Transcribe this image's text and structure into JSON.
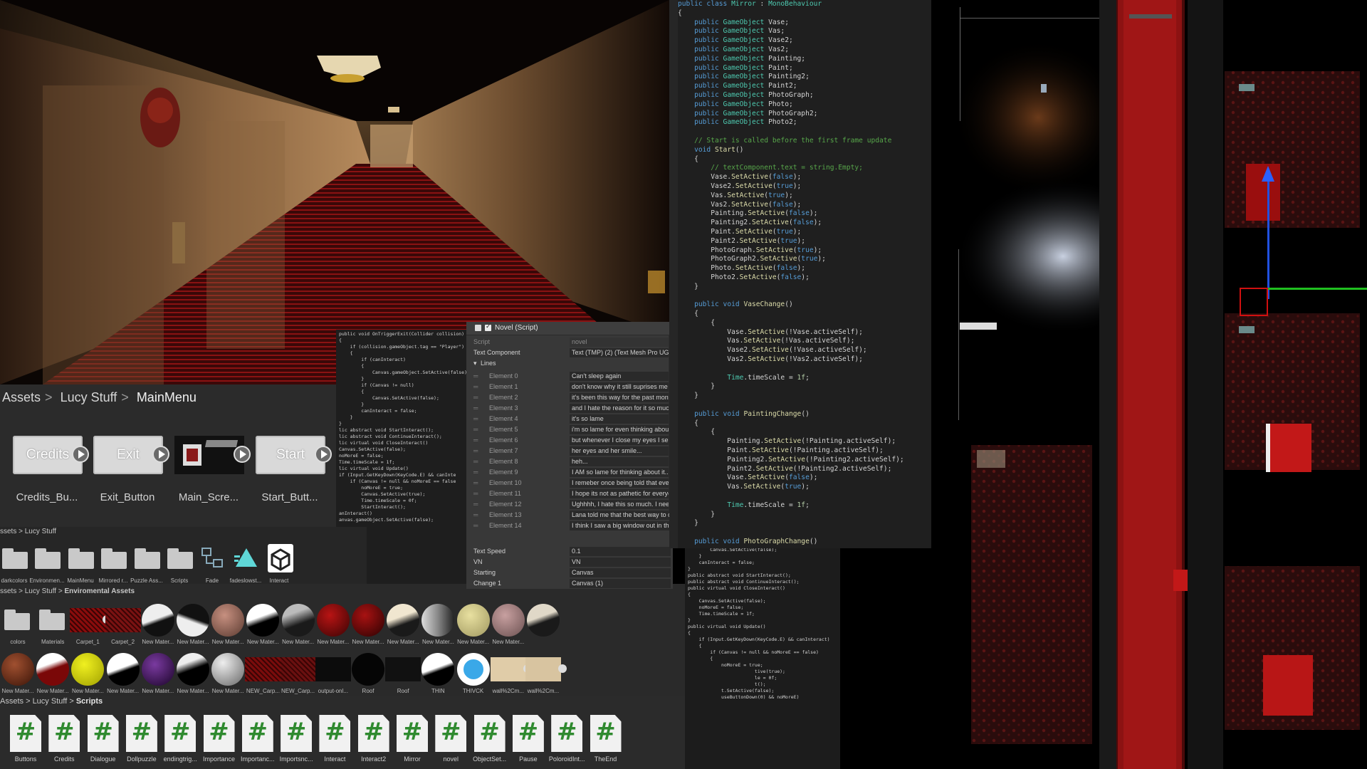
{
  "colors": {
    "accent_red": "#b11515",
    "editor_bg": "#1f1f1f",
    "panel_bg": "#2b2b2b"
  },
  "project": {
    "breadcrumb": [
      "Assets",
      "Lucy Stuff",
      "MainMenu"
    ],
    "prefabs": [
      {
        "card": "Credits",
        "label": "Credits_Bu..."
      },
      {
        "card": "Exit",
        "label": "Exit_Button"
      },
      {
        "card": "",
        "label": "Main_Scre..."
      },
      {
        "card": "Start",
        "label": "Start_Butt..."
      }
    ]
  },
  "folders_panel": {
    "breadcrumb": [
      "ssets",
      "Lucy Stuff"
    ],
    "items": [
      "darkcolors",
      "Environmen...",
      "MainMenu",
      "Mirrored r...",
      "Puzzle Ass...",
      "Scripts",
      "Fade",
      "fadeslowst...",
      "Interact"
    ]
  },
  "materials_panel": {
    "breadcrumb": [
      "ssets",
      "Lucy Stuff",
      "Enviromental Assets"
    ],
    "row1": [
      "colors",
      "Materials",
      "Carpet_1",
      "Carpet_2",
      "New Mater...",
      "New Mater...",
      "New Mater...",
      "New Mater...",
      "New Mater...",
      "New Mater...",
      "New Mater...",
      "New Mater...",
      "New Mater...",
      "New Mater...",
      "New Mater..."
    ],
    "row2": [
      "New Mater...",
      "New Mater...",
      "New Mater...",
      "New Mater...",
      "New Mater...",
      "New Mater...",
      "New Mater...",
      "NEW_Carp...",
      "NEW_Carp...",
      "output-onl...",
      "Roof",
      "Roof",
      "THIN",
      "THIVCK",
      "wall%2Cm...",
      "wall%2Cm..."
    ]
  },
  "scripts_panel": {
    "breadcrumb": [
      "Assets",
      "Lucy Stuff",
      "Scripts"
    ],
    "items": [
      "Buttons",
      "Credits",
      "Dialogue",
      "Dollpuzzle",
      "endingtrig...",
      "Importance",
      "Importanc...",
      "Importsnc...",
      "Interact",
      "Interact2",
      "Mirror",
      "novel",
      "ObjectSet...",
      "Pause",
      "PoloroidInt...",
      "TheEnd"
    ]
  },
  "inspector": {
    "header": "Novel (Script)",
    "script_label": "Script",
    "script_value": "novel",
    "text_component_label": "Text Component",
    "text_component_value": "Text (TMP) (2) (Text Mesh Pro UG",
    "lines_label": "Lines",
    "elements": [
      {
        "k": "Element 0",
        "v": "Can't sleep again"
      },
      {
        "k": "Element 1",
        "v": "don't know why it still suprises me"
      },
      {
        "k": "Element 2",
        "v": "it's been this way for the past montl"
      },
      {
        "k": "Element 3",
        "v": "and I hate the reason for it so much"
      },
      {
        "k": "Element 4",
        "v": "it's so lame"
      },
      {
        "k": "Element 5",
        "v": "i'm so lame for even thinking about"
      },
      {
        "k": "Element 6",
        "v": "but whenever I close my eyes I see"
      },
      {
        "k": "Element 7",
        "v": "her eyes and her smile..."
      },
      {
        "k": "Element 8",
        "v": "heh..."
      },
      {
        "k": "Element 9",
        "v": "I AM so lame for thinking about it..."
      },
      {
        "k": "Element 10",
        "v": "I remeber once being told that ever"
      },
      {
        "k": "Element 11",
        "v": "I hope its not as pathetic for everyo"
      },
      {
        "k": "Element 12",
        "v": "Ughhhh, I hate this so much. I nee"
      },
      {
        "k": "Element 13",
        "v": "Lana told me that the best way to c"
      },
      {
        "k": "Element 14",
        "v": "I think I saw a big window out in the"
      }
    ],
    "fields": [
      {
        "k": "Text Speed",
        "v": "0.1"
      },
      {
        "k": "VN",
        "v": "VN"
      },
      {
        "k": "Starting",
        "v": "Canvas"
      },
      {
        "k": "Change 1",
        "v": "Canvas (1)"
      }
    ]
  },
  "small_code_top": [
    "public void OnTriggerExit(Collider collision)",
    "{",
    "    if (collision.gameObject.tag == \"Player\")",
    "    {",
    "        if (canInteract)",
    "        {",
    "            Canvas.gameObject.SetActive(false);",
    "        }",
    "        if (Canvas != null)",
    "        {",
    "            Canvas.SetActive(false);",
    "        }",
    "        canInteract = false;",
    "    }",
    "}",
    "",
    "lic abstract void StartInteract();",
    "lic abstract void ContinueInteract();",
    "",
    "lic virtual void CloseInteract()",
    "",
    "Canvas.SetActive(false);",
    "noMoreE = false;",
    "Time.timeScale = 1f;",
    "",
    "",
    "lic virtual void Update()",
    "",
    "if (Input.GetKeyDown(KeyCode.E) && canInte",
    "",
    "    if (Canvas != null && noMoreE == false",
    "",
    "        noMoreE = true;",
    "        Canvas.SetActive(true);",
    "        Time.timeScale = 0f;",
    "",
    "        StartInteract();",
    "",
    "",
    "anInteract()",
    "",
    "anvas.gameObject.SetActive(false);"
  ],
  "small_code_bottom": [
    "        Canvas.SetActive(false);",
    "    }",
    "    canInteract = false;",
    "}",
    "",
    "public abstract void StartInteract();",
    "public abstract void ContinueInteract();",
    "",
    "public virtual void CloseInteract()",
    "{",
    "    Canvas.SetActive(false);",
    "    noMoreE = false;",
    "    Time.timeScale = 1f;",
    "}",
    "",
    "public virtual void Update()",
    "{",
    "    if (Input.GetKeyDown(KeyCode.E) && canInteract)",
    "    {",
    "        if (Canvas != null && noMoreE == false)",
    "        {",
    "            noMoreE = true;",
    "                        tive(true);",
    "                        le = 0f;",
    "",
    "                        t();",
    "",
    "",
    "",
    "",
    "",
    "            t.SetActive(false);",
    "",
    "            useButtonDown(0) && noMoreE)"
  ]
}
